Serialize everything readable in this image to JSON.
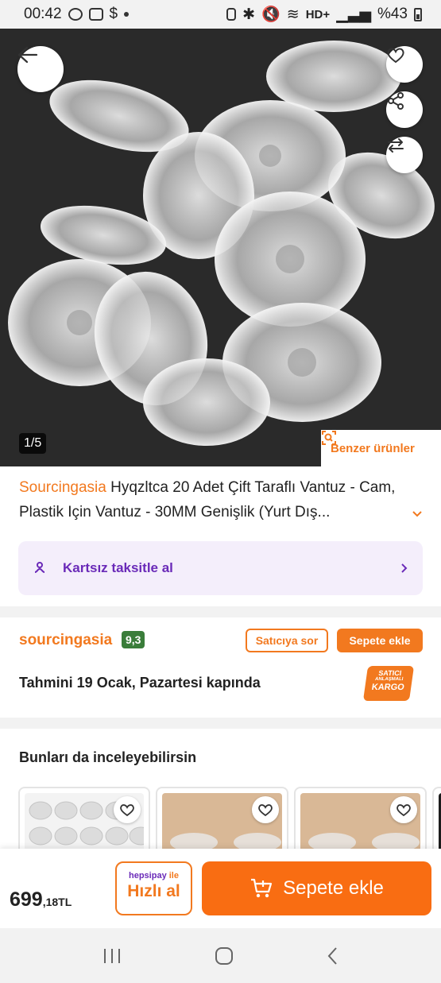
{
  "status_bar": {
    "time": "00:42",
    "battery": "%43",
    "network": "HD+"
  },
  "gallery": {
    "counter": "1/5",
    "similar_label": "Benzer ürünler"
  },
  "product": {
    "brand": "Sourcingasia",
    "title": " Hyqzltca 20 Adet Çift Taraflı Vantuz - Cam, Plastik Için Vantuz - 30MM Genişlik (Yurt Dış..."
  },
  "installment": {
    "label": "Kartsız taksitle al"
  },
  "seller": {
    "name": "sourcingasia",
    "rating": "9,3",
    "ask_label": "Satıcıya sor",
    "add_label": "Sepete ekle",
    "delivery": "Tahmini 19 Ocak, Pazartesi kapında",
    "kargo_badge": {
      "line1": "SATICI",
      "line2": "ANLAŞMALI",
      "line3": "KARGO"
    }
  },
  "recommendations": {
    "title": "Bunları da inceleyebilirsin"
  },
  "bottom_bar": {
    "price_main": "699",
    "price_sub": ",18TL",
    "quick_buy_brand": "hepsipay",
    "quick_buy_suffix": " ile",
    "quick_buy_label": "Hızlı al",
    "add_to_cart": "Sepete ekle"
  },
  "colors": {
    "accent": "#f2791f",
    "purple": "#6a2ab8",
    "rating_green": "#3a7d3a"
  }
}
